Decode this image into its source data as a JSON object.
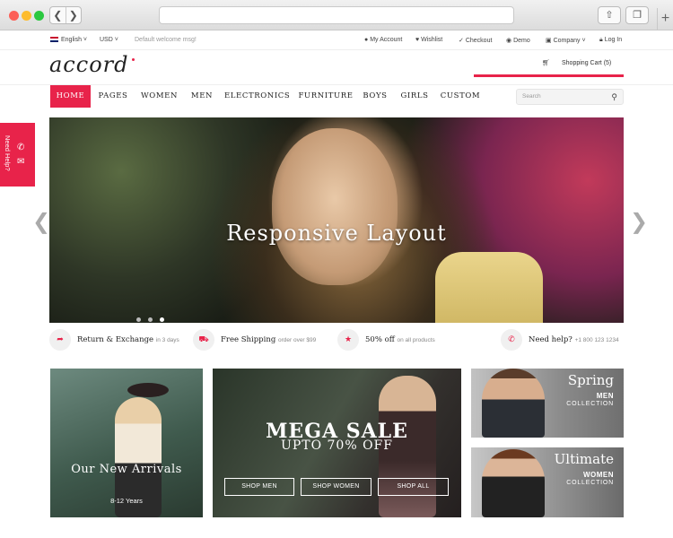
{
  "topbar": {
    "language": "English",
    "currency": "USD",
    "welcome": "Default welcome msg!",
    "links": [
      "My Account",
      "Wishlist",
      "Checkout",
      "Demo",
      "Company",
      "Log In"
    ]
  },
  "header": {
    "logo": "accord",
    "cart_label": "Shopping Cart (5)"
  },
  "nav": {
    "items": [
      "HOME",
      "PAGES",
      "WOMEN",
      "MEN",
      "ELECTRONICS",
      "FURNITURE",
      "BOYS",
      "GIRLS",
      "CUSTOM"
    ],
    "search_placeholder": "Search"
  },
  "sidebar": {
    "need_help": "Need Help?"
  },
  "hero": {
    "title": "Responsive Layout",
    "slides": 3,
    "active_slide": 3
  },
  "features": [
    {
      "title": "Return & Exchange",
      "sub": "in 3 days",
      "icon": "arrow-icon"
    },
    {
      "title": "Free Shipping",
      "sub": "order over $99",
      "icon": "truck-icon"
    },
    {
      "title": "50% off",
      "sub": "on all products",
      "icon": "star-icon"
    },
    {
      "title": "Need help?",
      "sub": "+1 800 123 1234",
      "icon": "phone-icon"
    }
  ],
  "banners": {
    "arrivals": {
      "title": "Our New Arrivals",
      "sub": "8-12 Years"
    },
    "sale": {
      "title": "MEGA SALE",
      "sub": "UPTO 70% OFF",
      "buttons": [
        "SHOP MEN",
        "SHOP WOMEN",
        "SHOP ALL"
      ]
    },
    "men": {
      "title": "Spring",
      "label": "MEN",
      "sub": "COLLECTION"
    },
    "women": {
      "title": "Ultimate",
      "label": "WOMEN",
      "sub": "COLLECTION"
    }
  },
  "colors": {
    "accent": "#e8234a"
  }
}
